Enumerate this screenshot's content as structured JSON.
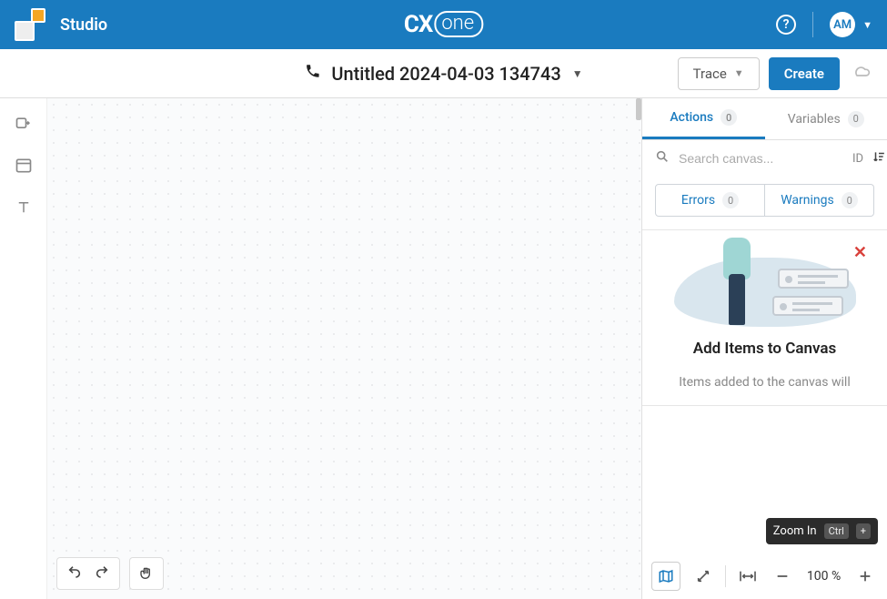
{
  "app": {
    "title": "Studio",
    "brand_cx": "CX",
    "brand_one": "one"
  },
  "user": {
    "initials": "AM"
  },
  "help": {
    "label": "?"
  },
  "toolbar": {
    "doc_title": "Untitled 2024-04-03 134743",
    "trace_label": "Trace",
    "create_label": "Create"
  },
  "panel": {
    "tabs": {
      "actions": {
        "label": "Actions",
        "count": "0"
      },
      "variables": {
        "label": "Variables",
        "count": "0"
      }
    },
    "search": {
      "placeholder": "Search canvas...",
      "id_label": "ID"
    },
    "errwarn": {
      "errors": {
        "label": "Errors",
        "count": "0"
      },
      "warnings": {
        "label": "Warnings",
        "count": "0"
      }
    },
    "empty": {
      "title": "Add Items to Canvas",
      "desc": "Items added to the canvas will"
    }
  },
  "zoom": {
    "pct": "100 %",
    "tooltip_label": "Zoom In",
    "tooltip_key1": "Ctrl",
    "tooltip_key2": "+"
  }
}
